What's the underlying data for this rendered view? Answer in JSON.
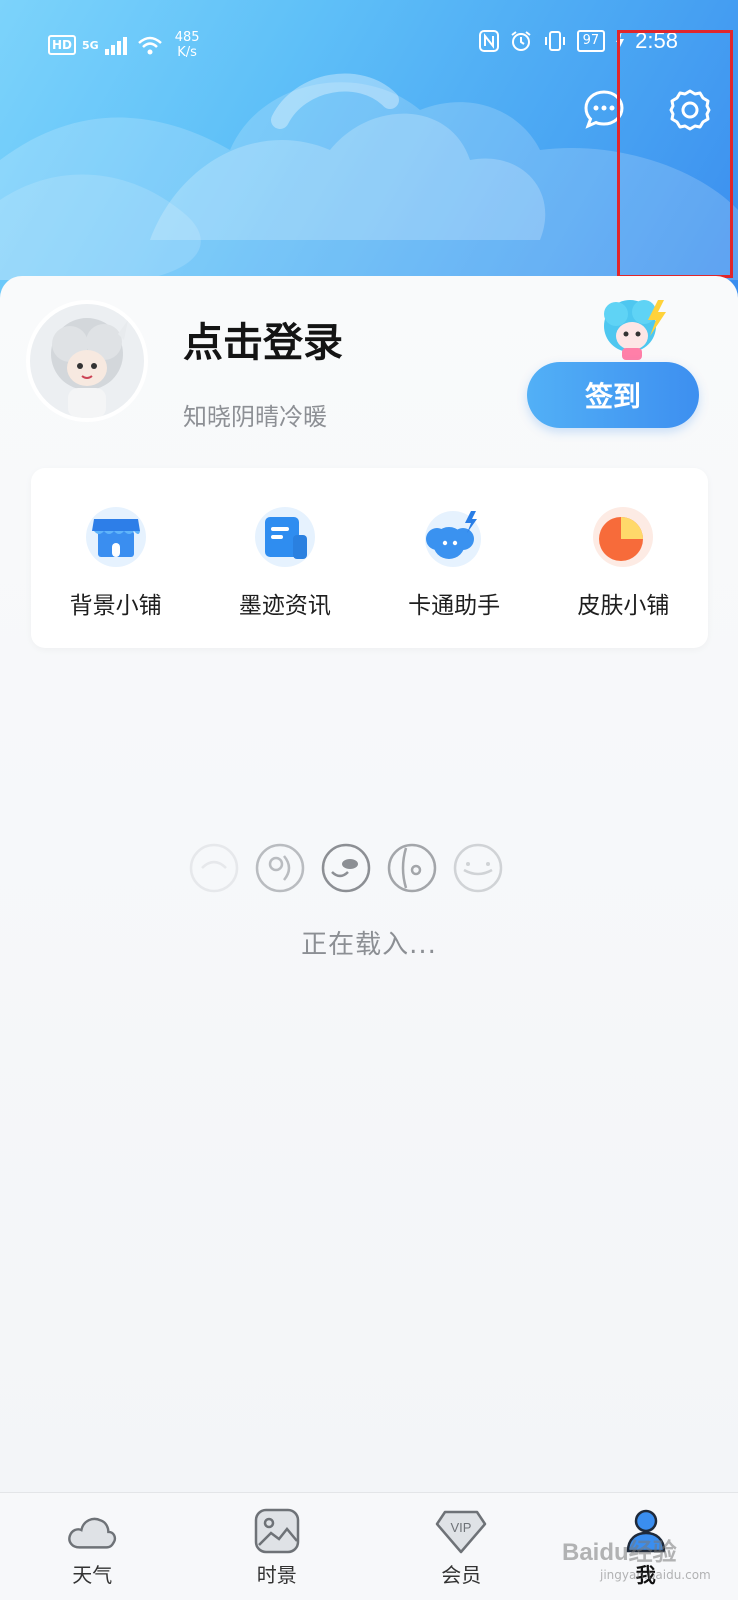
{
  "status_bar": {
    "hd": "HD",
    "network": "5G",
    "speed_value": "485",
    "speed_unit": "K/s",
    "battery": "97",
    "time": "2:58"
  },
  "profile": {
    "title": "点击登录",
    "subtitle": "知晓阴晴冷暖",
    "checkin_label": "签到"
  },
  "shortcuts": [
    {
      "label": "背景小铺",
      "icon": "storefront-icon"
    },
    {
      "label": "墨迹资讯",
      "icon": "news-icon"
    },
    {
      "label": "卡通助手",
      "icon": "cartoon-assistant-icon"
    },
    {
      "label": "皮肤小铺",
      "icon": "skin-shop-icon"
    }
  ],
  "loading": {
    "text": "正在载入..."
  },
  "bottom_nav": [
    {
      "label": "天气",
      "icon": "weather-cloud-icon",
      "active": false
    },
    {
      "label": "时景",
      "icon": "photo-icon",
      "active": false
    },
    {
      "label": "会员",
      "icon": "vip-icon",
      "active": false
    },
    {
      "label": "我",
      "icon": "profile-icon",
      "active": true
    }
  ],
  "watermark": {
    "text": "Baidu经验",
    "sub": "jingyan.baidu.com"
  },
  "colors": {
    "header_start": "#7cd3fb",
    "header_end": "#3a8def",
    "accent": "#3d8ff0",
    "highlight": "#e0262c"
  }
}
